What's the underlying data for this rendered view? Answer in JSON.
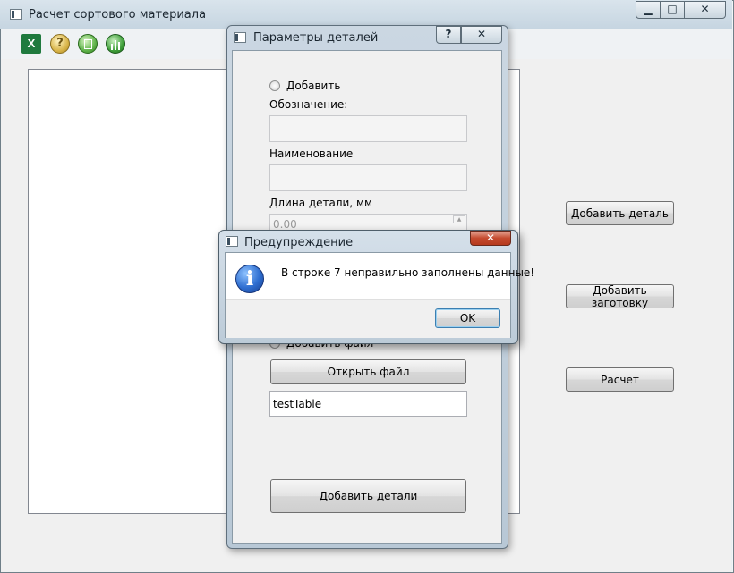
{
  "main_window": {
    "title": "Расчет сортового материала",
    "caption_buttons": {
      "minimize": "▁",
      "maximize": "□",
      "close": "✕"
    },
    "toolbar_icons": [
      "excel-icon",
      "help-icon",
      "materials-icon",
      "chart-icon"
    ],
    "buttons": {
      "add_detail": "Добавить деталь",
      "add_blank": "Добавить заготовку",
      "calculate": "Расчет"
    }
  },
  "params_dialog": {
    "title": "Параметры деталей",
    "help_button": "?",
    "close_button": "✕",
    "add_radio_label": "Добавить",
    "designation_label": "Обозначение:",
    "designation_value": "",
    "name_label": "Наименование",
    "name_value": "",
    "length_label": "Длина детали, мм",
    "length_value": "0.00",
    "add_file_radio_label": "Добавить файл",
    "open_file_button": "Открыть файл",
    "file_name_value": "testTable",
    "add_details_button": "Добавить детали"
  },
  "warning_dialog": {
    "title": "Предупреждение",
    "message": "В строке 7 неправильно заполнены данные!",
    "ok_button": "OK",
    "close_button": "✕",
    "icon": "info-icon"
  },
  "colors": {
    "title_bar": "#c6d5e1",
    "client_bg": "#f0f0f0",
    "close_red": "#c54a2e",
    "info_blue": "#2f6fd1"
  }
}
